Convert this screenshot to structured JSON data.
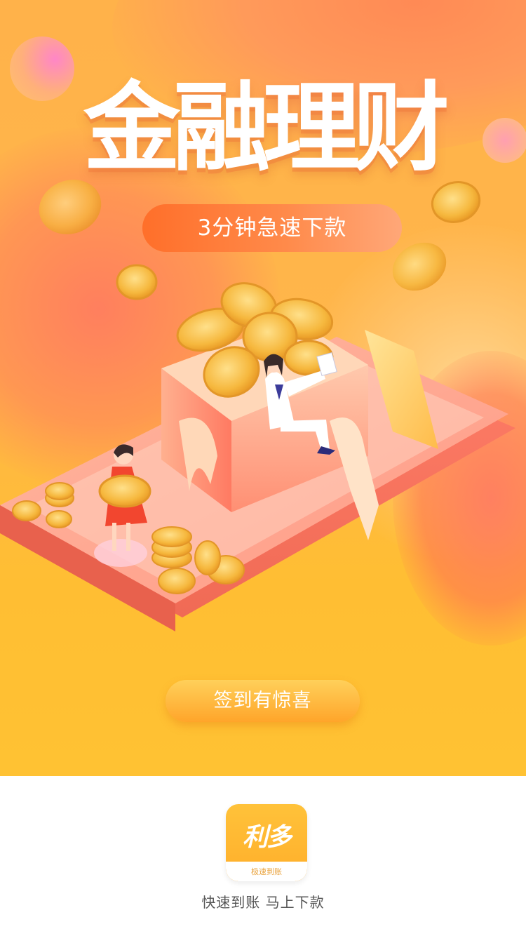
{
  "hero": {
    "title": "金融理财",
    "badge_text": "3分钟急速下款",
    "cta_label": "签到有惊喜"
  },
  "app": {
    "logo_mark": "利多",
    "logo_subtitle": "极速到账",
    "tagline": "快速到账 马上下款"
  },
  "colors": {
    "accent_orange": "#ff8a2a",
    "accent_yellow": "#ffc233",
    "coin_gold": "#f4b23a"
  }
}
